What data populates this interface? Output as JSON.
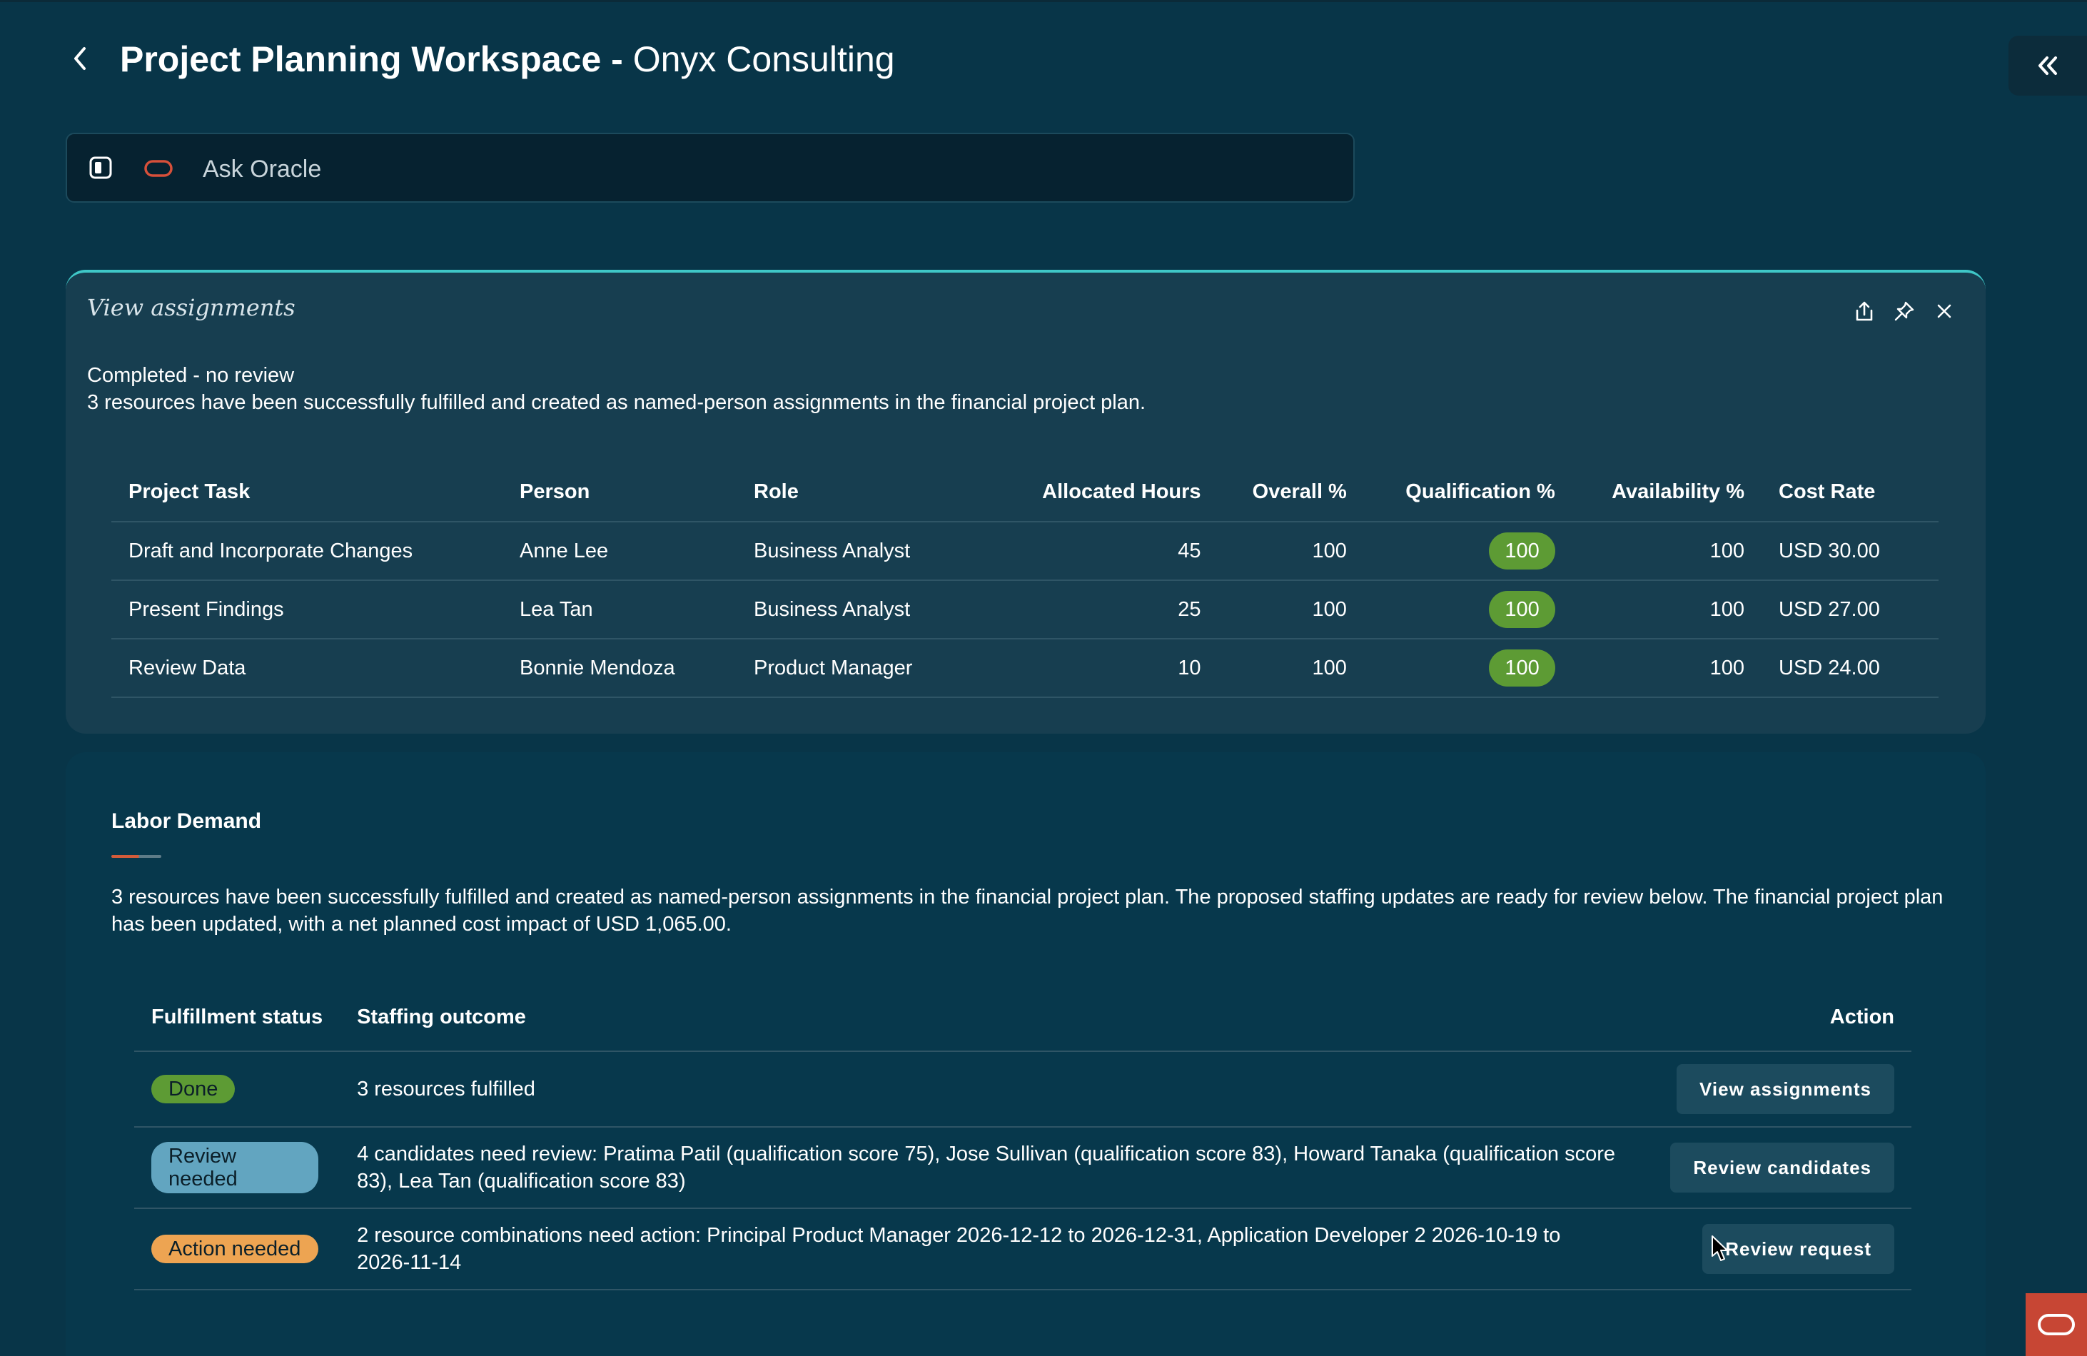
{
  "header": {
    "title_bold": "Project Planning Workspace -",
    "title_light": "Onyx Consulting"
  },
  "ask": {
    "placeholder": "Ask Oracle"
  },
  "assignments_card": {
    "title": "View assignments",
    "status": "Completed - no review",
    "summary": "3 resources have been successfully fulfilled and created as named-person assignments in the financial project plan.",
    "columns": [
      "Project Task",
      "Person",
      "Role",
      "Allocated Hours",
      "Overall %",
      "Qualification %",
      "Availability %",
      "Cost Rate"
    ],
    "rows": [
      {
        "task": "Draft and Incorporate Changes",
        "person": "Anne Lee",
        "role": "Business Analyst",
        "hours": "45",
        "overall": "100",
        "qualification": "100",
        "availability": "100",
        "cost": "USD 30.00"
      },
      {
        "task": "Present Findings",
        "person": "Lea Tan",
        "role": "Business Analyst",
        "hours": "25",
        "overall": "100",
        "qualification": "100",
        "availability": "100",
        "cost": "USD 27.00"
      },
      {
        "task": "Review Data",
        "person": "Bonnie Mendoza",
        "role": "Product Manager",
        "hours": "10",
        "overall": "100",
        "qualification": "100",
        "availability": "100",
        "cost": "USD 24.00"
      }
    ]
  },
  "labor_card": {
    "title": "Labor Demand",
    "description": "3 resources have been successfully fulfilled and created as named-person assignments in the financial project plan. The proposed staffing updates are ready for review below. The financial project plan has been updated, with a net planned cost impact of USD 1,065.00.",
    "columns": {
      "status": "Fulfillment status",
      "outcome": "Staffing outcome",
      "action": "Action"
    },
    "rows": [
      {
        "status": "Done",
        "outcome": "3 resources fulfilled",
        "action": "View assignments"
      },
      {
        "status": "Review needed",
        "outcome": "4 candidates need review: Pratima Patil (qualification score 75), Jose Sullivan (qualification score 83), Howard Tanaka (qualification score 83), Lea Tan (qualification score 83)",
        "action": "Review candidates"
      },
      {
        "status": "Action needed",
        "outcome": "2 resource combinations need action: Principal Product Manager 2026-12-12 to 2026-12-31, Application Developer 2 2026-10-19 to 2026-11-14",
        "action": "Review request"
      }
    ]
  },
  "colors": {
    "background": "#083548",
    "accent_teal": "#3fc7c7",
    "done": "#5d9b34",
    "review": "#62a5c0",
    "action": "#eda452",
    "oracle_red": "#c74634"
  },
  "icons": [
    "chevron-left-icon",
    "double-chevron-left-icon",
    "panel-icon",
    "oracle-logo-icon",
    "share-icon",
    "pin-icon",
    "close-icon"
  ]
}
